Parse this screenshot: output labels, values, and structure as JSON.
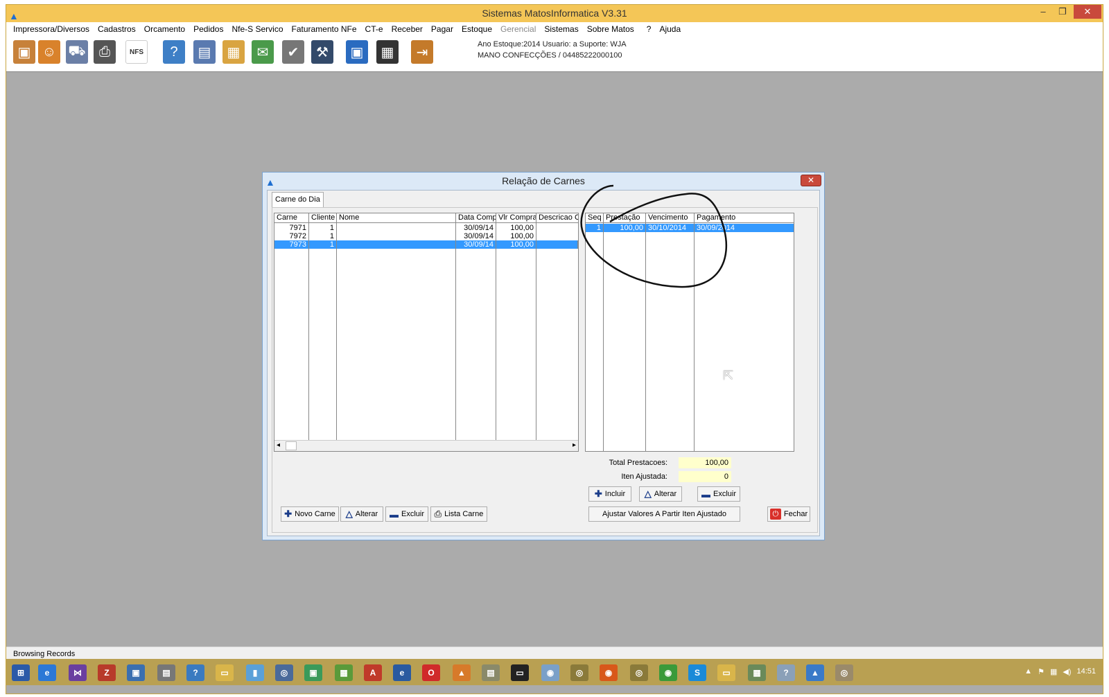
{
  "app": {
    "title": "Sistemas MatosInformatica V3.31",
    "window_controls": [
      "–",
      "❐",
      "✕"
    ]
  },
  "menu": [
    "Impressora/Diversos",
    "Cadastros",
    "Orcamento",
    "Pedidos",
    "Nfe-S Servico",
    "Faturamento NFe",
    "CT-e",
    "Receber",
    "Pagar",
    "Estoque",
    "Gerencial",
    "Sistemas",
    "Sobre Matos",
    "Ajuda"
  ],
  "toolbar_info": {
    "line1": "Ano Estoque:2014 Usuario: a Suporte: WJA",
    "line2": "MANO CONFECÇÕES / 04485222000100"
  },
  "toolbar_icons": [
    "gift-icon",
    "people-icon",
    "truck-icon",
    "printer-icon",
    "nfse-icon",
    "help-icon",
    "document-icon",
    "box-icon",
    "mail-icon",
    "check-icon",
    "tools-icon",
    "save-icon",
    "calculator-icon",
    "exit-icon"
  ],
  "toolbar_icon_glyphs": {
    "nfse": "NFS"
  },
  "dialog": {
    "title": "Relação de Carnes",
    "tab": "Carne do Dia",
    "left_grid": {
      "columns": [
        "Carne",
        "Cliente",
        "Nome",
        "Data Comp",
        "Vlr Compra",
        "Descricao Co"
      ],
      "rows": [
        [
          "7971",
          "1",
          "",
          "30/09/14",
          "100,00",
          ""
        ],
        [
          "7972",
          "1",
          "",
          "30/09/14",
          "100,00",
          ""
        ],
        [
          "7973",
          "1",
          "",
          "30/09/14",
          "100,00",
          ""
        ]
      ]
    },
    "right_grid": {
      "columns": [
        "Seq",
        "Prestação",
        "Vencimento",
        "Pagamento"
      ],
      "rows": [
        [
          "1",
          "100,00",
          "30/10/2014",
          "30/09/2014"
        ]
      ]
    },
    "totals": {
      "total_prestacoes_label": "Total Prestacoes:",
      "total_prestacoes_value": "100,00",
      "iten_ajustada_label": "Iten Ajustada:",
      "iten_ajustada_value": "0"
    },
    "buttons": {
      "incluir": "Incluir",
      "alterar_right": "Alterar",
      "excluir_right": "Excluir",
      "novo_carne": "Novo Carne",
      "alterar_left": "Alterar",
      "excluir_left": "Excluir",
      "lista_carne": "Lista Carne",
      "ajustar": "Ajustar Valores A Partir Iten Ajustado",
      "fechar": "Fechar"
    }
  },
  "status_bar": "Browsing Records",
  "clock": "14:51"
}
